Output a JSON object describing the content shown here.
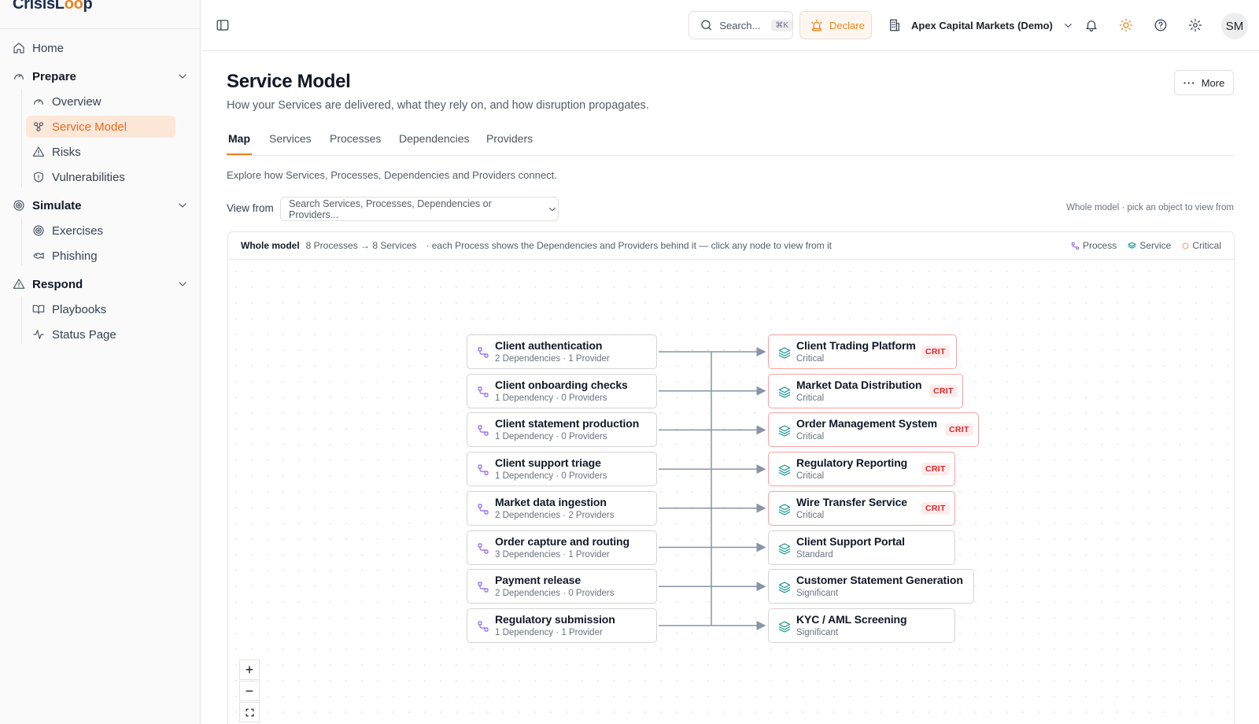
{
  "brand": {
    "name_prefix": "CrisisL",
    "name_oo": "oo",
    "name_suffix": "p"
  },
  "sidebar": {
    "home": "Home",
    "prepare": {
      "label": "Prepare",
      "items": [
        "Overview",
        "Service Model",
        "Risks",
        "Vulnerabilities"
      ]
    },
    "simulate": {
      "label": "Simulate",
      "items": [
        "Exercises",
        "Phishing"
      ]
    },
    "respond": {
      "label": "Respond",
      "items": [
        "Playbooks",
        "Status Page"
      ]
    }
  },
  "topbar": {
    "search_label": "Search...",
    "search_shortcut": "⌘K",
    "declare_label": "Declare",
    "org_name": "Apex Capital Markets (Demo)",
    "avatar_initials": "SM"
  },
  "page": {
    "title": "Service Model",
    "subtitle": "How your Services are delivered, what they rely on, and how disruption propagates.",
    "more_label": "More",
    "tabs": [
      "Map",
      "Services",
      "Processes",
      "Dependencies",
      "Providers"
    ],
    "active_tab": "Map",
    "explore_text": "Explore how Services, Processes, Dependencies and Providers connect.",
    "view_from_label": "View from",
    "view_from_placeholder": "Search Services, Processes, Dependencies or Providers...",
    "view_from_hint": "Whole model · pick an object to view from"
  },
  "map": {
    "title": "Whole model",
    "counts": "8 Processes → 8 Services",
    "hint": "· each Process shows the Dependencies and Providers behind it — click any node to view from it",
    "legend": {
      "process": "Process",
      "service": "Service",
      "critical": "Critical"
    },
    "crit_badge": "CRIT",
    "processes": [
      {
        "name": "Client authentication",
        "detail": "2 Dependencies · 1 Provider"
      },
      {
        "name": "Client onboarding checks",
        "detail": "1 Dependency · 0 Providers"
      },
      {
        "name": "Client statement production",
        "detail": "1 Dependency · 0 Providers"
      },
      {
        "name": "Client support triage",
        "detail": "1 Dependency · 0 Providers"
      },
      {
        "name": "Market data ingestion",
        "detail": "2 Dependencies · 2 Providers"
      },
      {
        "name": "Order capture and routing",
        "detail": "3 Dependencies · 1 Provider"
      },
      {
        "name": "Payment release",
        "detail": "2 Dependencies · 0 Providers"
      },
      {
        "name": "Regulatory submission",
        "detail": "1 Dependency · 1 Provider"
      }
    ],
    "services": [
      {
        "name": "Client Trading Platform",
        "tier": "Critical",
        "critical": true
      },
      {
        "name": "Market Data Distribution",
        "tier": "Critical",
        "critical": true
      },
      {
        "name": "Order Management System",
        "tier": "Critical",
        "critical": true
      },
      {
        "name": "Regulatory Reporting",
        "tier": "Critical",
        "critical": true
      },
      {
        "name": "Wire Transfer Service",
        "tier": "Critical",
        "critical": true
      },
      {
        "name": "Client Support Portal",
        "tier": "Standard",
        "critical": false
      },
      {
        "name": "Customer Statement Generation",
        "tier": "Significant",
        "critical": false
      },
      {
        "name": "KYC / AML Screening",
        "tier": "Significant",
        "critical": false
      }
    ],
    "zoom_in": "+",
    "zoom_out": "−"
  },
  "colors": {
    "accent": "#e8841f",
    "process_icon": "#8b5cf6",
    "service_icon": "#0d9488",
    "critical": "#dc2626"
  },
  "icons": {
    "process": "process-flow-icon",
    "service": "layers-icon",
    "critical": "critical-ring-icon"
  }
}
